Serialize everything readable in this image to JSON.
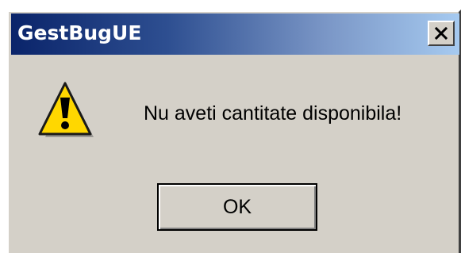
{
  "window": {
    "title": "GestBugUE",
    "close_glyph": "×"
  },
  "dialog": {
    "icon": "warning-icon",
    "message": "Nu aveti cantitate disponibila!",
    "ok_label": "OK"
  },
  "colors": {
    "title_bar_start": "#0a246a",
    "title_bar_end": "#a6caf0",
    "dialog_face": "#d4d0c8",
    "warning_yellow": "#ffd700"
  }
}
